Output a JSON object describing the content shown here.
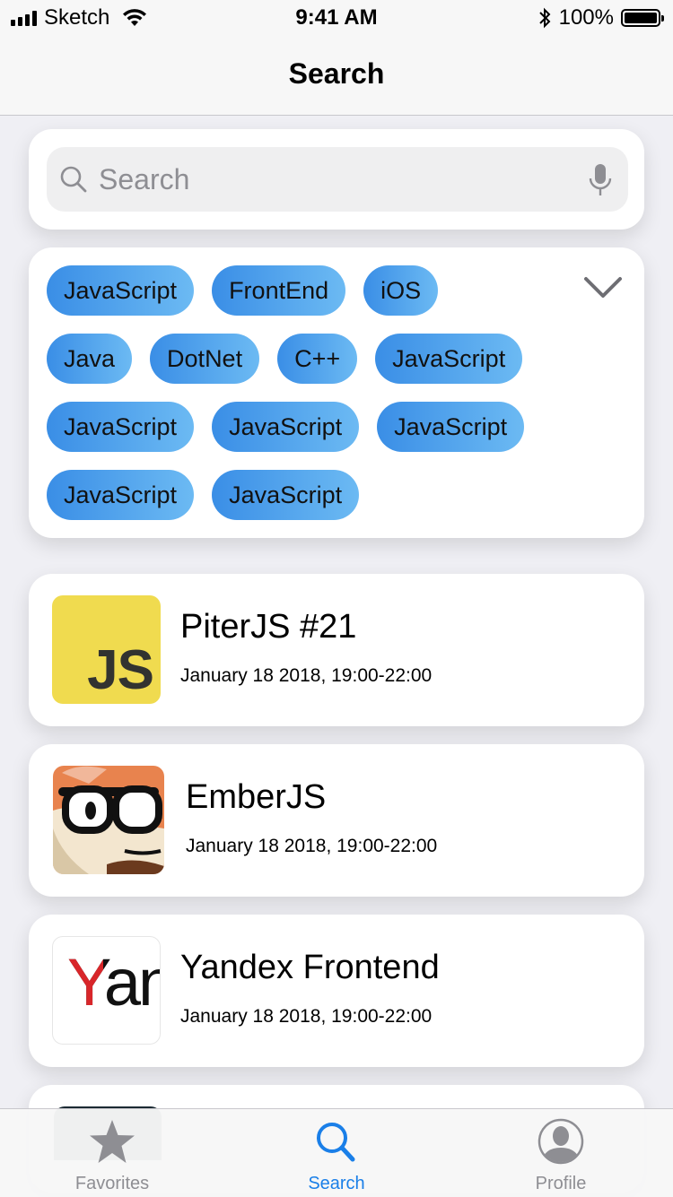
{
  "status_bar": {
    "carrier": "Sketch",
    "time": "9:41 AM",
    "battery_percent": "100%"
  },
  "nav": {
    "title": "Search"
  },
  "search": {
    "placeholder": "Search"
  },
  "tags": [
    "JavaScript",
    "FrontEnd",
    "iOS",
    "Java",
    "DotNet",
    "C++",
    "JavaScript",
    "JavaScript",
    "JavaScript",
    "JavaScript",
    "JavaScript",
    "JavaScript"
  ],
  "events": [
    {
      "title": "PiterJS #21",
      "date": "January 18 2018, 19:00-22:00",
      "logo_text": "JS"
    },
    {
      "title": "EmberJS",
      "date": "January 18 2018, 19:00-22:00"
    },
    {
      "title": "Yandex Frontend",
      "date": "January 18 2018, 19:00-22:00",
      "logo_text": "Yan"
    }
  ],
  "tabbar": {
    "items": [
      {
        "label": "Favorites",
        "icon": "star-icon",
        "active": false
      },
      {
        "label": "Search",
        "icon": "search-icon",
        "active": true
      },
      {
        "label": "Profile",
        "icon": "profile-icon",
        "active": false
      }
    ],
    "active_color": "#1a7fe8",
    "inactive_color": "#8e8e93"
  },
  "colors": {
    "tag_gradient_start": "#3a8ee6",
    "tag_gradient_end": "#6cbaf3",
    "js_logo_bg": "#f0db4f",
    "yandex_red": "#d8262a"
  }
}
